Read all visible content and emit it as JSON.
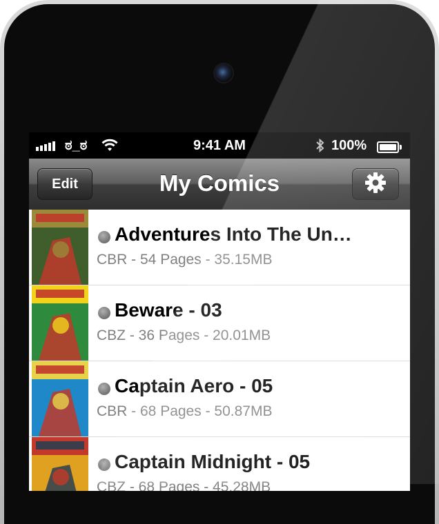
{
  "status_bar": {
    "carrier": "ಠ_ಠ",
    "time": "9:41 AM",
    "battery_percent": "100%",
    "battery_level": 1.0,
    "icons": [
      "signal-bars-icon",
      "wifi-icon",
      "bluetooth-icon",
      "battery-icon"
    ]
  },
  "nav": {
    "edit_label": "Edit",
    "title": "My Comics",
    "settings_icon": "gear-icon"
  },
  "comics": [
    {
      "title": "Adventures Into The Un…",
      "subtitle": "CBR - 54 Pages - 35.15MB",
      "cover_colors": [
        "#3f5e2c",
        "#9a8a3a",
        "#c0392b"
      ]
    },
    {
      "title": "Beware - 03",
      "subtitle": "CBZ - 36 Pages - 20.01MB",
      "cover_colors": [
        "#2e8b3e",
        "#f2d21b",
        "#c0392b"
      ]
    },
    {
      "title": "Captain Aero - 05",
      "subtitle": "CBR - 68 Pages - 50.87MB",
      "cover_colors": [
        "#1e88c8",
        "#e8d24a",
        "#c0392b"
      ]
    },
    {
      "title": "Captain Midnight - 05",
      "subtitle": "CBZ - 68 Pages - 45.28MB",
      "cover_colors": [
        "#e0a020",
        "#c0392b",
        "#2c3e50"
      ]
    }
  ]
}
